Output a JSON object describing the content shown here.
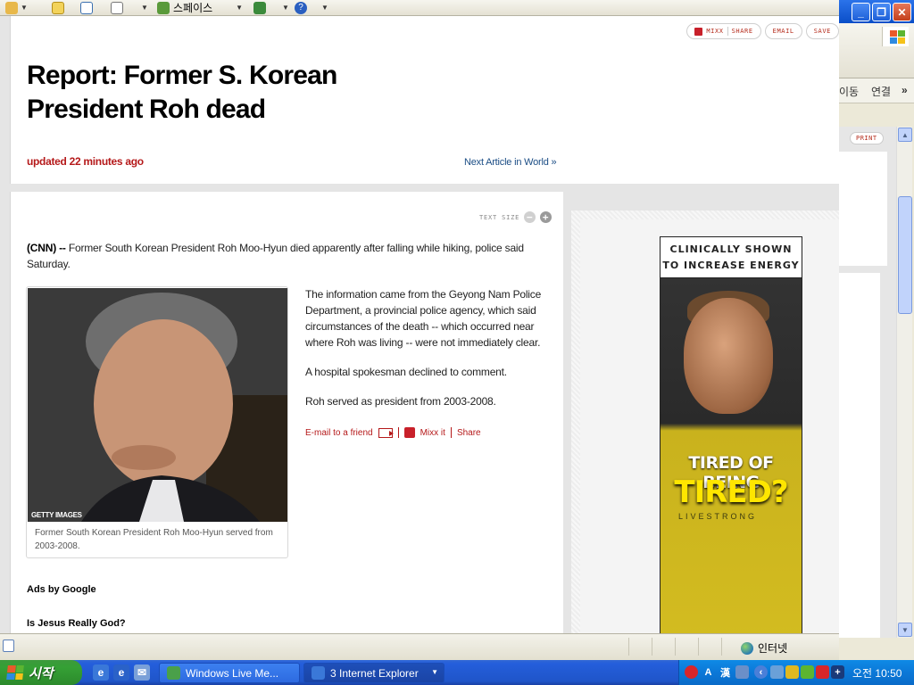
{
  "browser": {
    "toolbar": {
      "spaces_label": "스페이스"
    },
    "links": {
      "move_label": "이동",
      "links_label": "연결"
    },
    "print_label": "PRINT",
    "status": {
      "zone": "인터넷"
    }
  },
  "article": {
    "share_bar": {
      "mixx": "MIXX",
      "share": "SHARE",
      "email": "EMAIL",
      "save": "SAVE"
    },
    "headline_line1": "Report: Former S. Korean",
    "headline_line2": "President Roh dead",
    "updated": "updated 22 minutes ago",
    "next_article": "Next Article in World »",
    "text_size_label": "TEXT SIZE",
    "lead_source": "(CNN) --",
    "lead_text": " Former South Korean President Roh Moo-Hyun died apparently after falling while hiking, police said Saturday.",
    "photo_credit": "GETTY IMAGES",
    "photo_caption": "Former South Korean President Roh Moo-Hyun served from 2003-2008.",
    "paragraphs": [
      "The information came from the Geyong Nam Police Department, a provincial police agency, which said circumstances of the death -- which occurred near where Roh was living -- were not immediately clear.",
      "A hospital spokesman declined to comment.",
      "Roh served as president from 2003-2008."
    ],
    "actions": {
      "email": "E-mail to a friend",
      "mixx": "Mixx it",
      "share": "Share"
    },
    "ads_label": "Ads by Google",
    "ad_link": "Is Jesus Really God?"
  },
  "ad_banner": {
    "line1": "CLINICALLY SHOWN",
    "line2": "TO INCREASE ENERGY",
    "tag1": "TIRED OF BEING",
    "tag2": "TIRED?",
    "brand": "LIVESTRONG"
  },
  "taskbar": {
    "start": "시작",
    "tasks": [
      {
        "label": "Windows Live Me..."
      },
      {
        "label": "3 Internet Explorer"
      }
    ],
    "clock": "오전 10:50"
  },
  "colors": {
    "cnn_red": "#b5191a",
    "link_blue": "#1b4d85",
    "xp_blue": "#245edb",
    "start_green": "#35a035"
  }
}
